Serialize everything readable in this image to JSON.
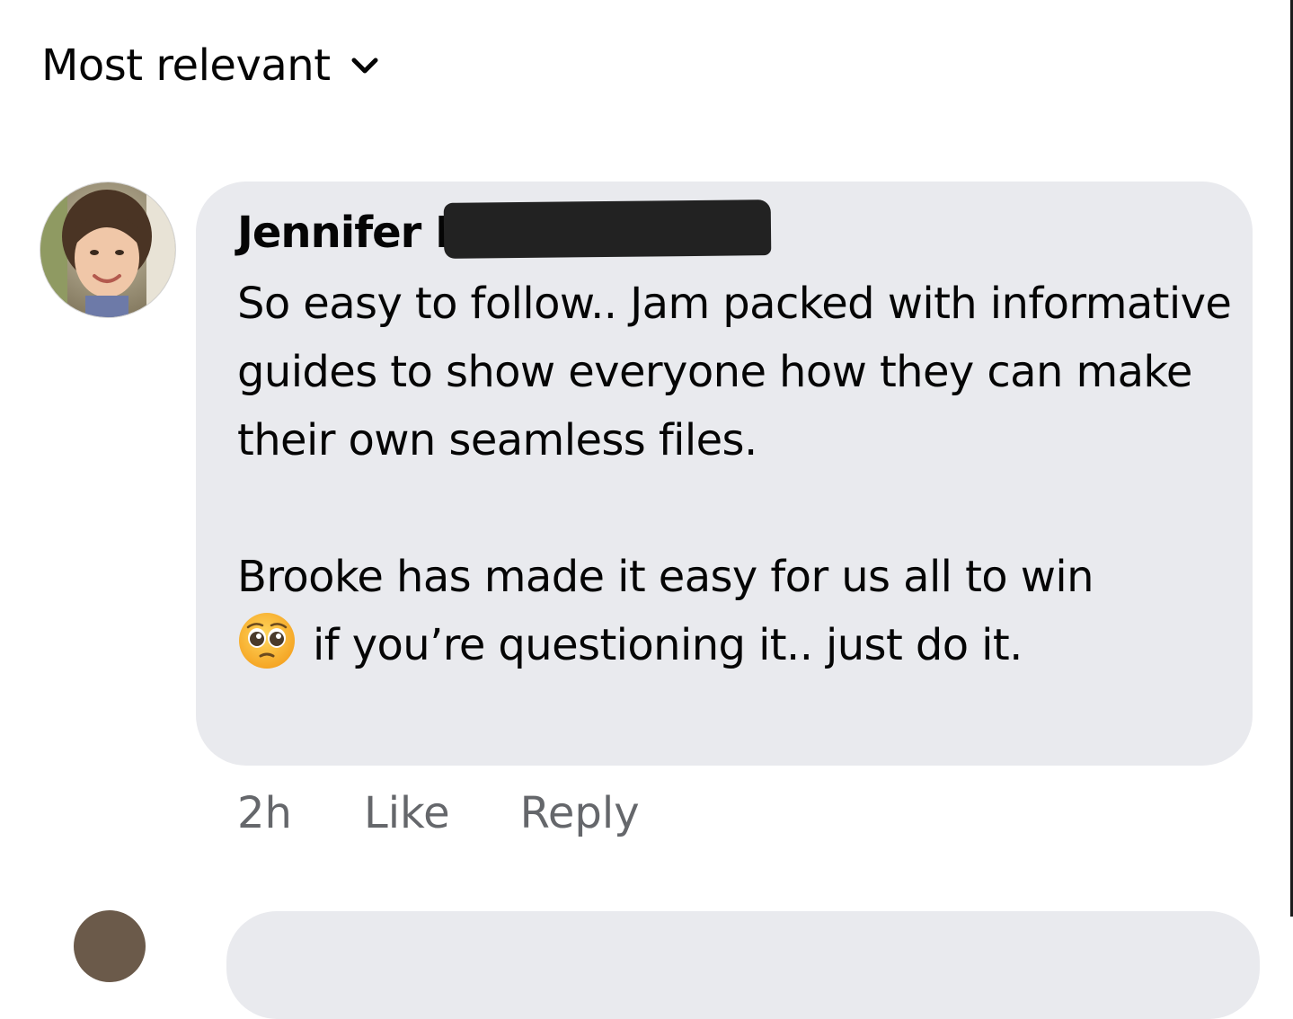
{
  "sort": {
    "label": "Most relevant",
    "icon": "chevron-down-icon"
  },
  "comment": {
    "avatar_icon": "profile-photo-icon",
    "author": "Jennifer D",
    "paragraphs": [
      "So easy to follow.. Jam packed with informative guides to show everyone how they can make their own seamless files.",
      "if you’re questioning it.. just do it."
    ],
    "paragraph2_lead": "Brooke has made it easy for us all to win",
    "emoji": "pleading-face-emoji-icon",
    "time": "2h",
    "like_label": "Like",
    "reply_label": "Reply"
  },
  "colors": {
    "bubble_bg": "#e9eaee",
    "meta_text": "#65676b",
    "text": "#050505"
  }
}
